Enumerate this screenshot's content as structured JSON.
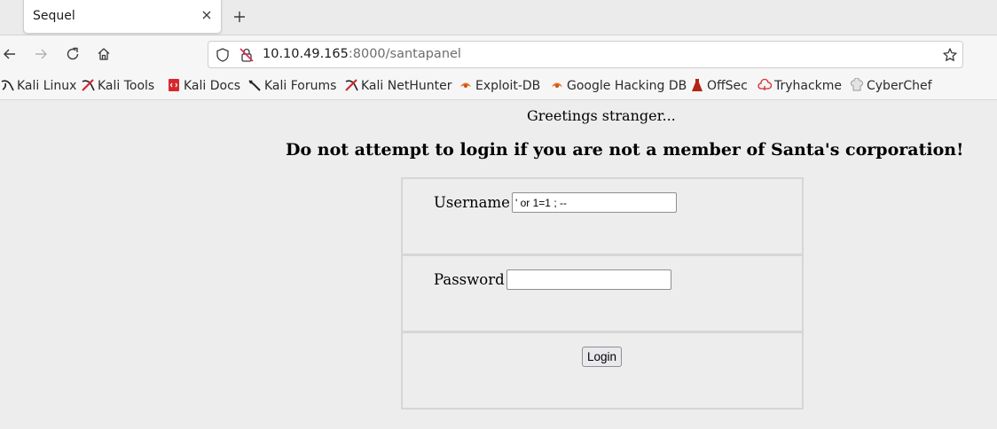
{
  "browser": {
    "tab_title": "Sequel",
    "url": {
      "host": "10.10.49.165",
      "rest": ":8000/santapanel"
    },
    "bookmarks": [
      {
        "label": "Kali Linux",
        "icon": "kali-dragon-icon"
      },
      {
        "label": "Kali Tools",
        "icon": "kali-tools-icon"
      },
      {
        "label": "Kali Docs",
        "icon": "kali-docs-icon"
      },
      {
        "label": "Kali Forums",
        "icon": "kali-forums-icon"
      },
      {
        "label": "Kali NetHunter",
        "icon": "kali-nethunter-icon"
      },
      {
        "label": "Exploit-DB",
        "icon": "exploit-db-icon"
      },
      {
        "label": "Google Hacking DB",
        "icon": "ghdb-icon"
      },
      {
        "label": "OffSec",
        "icon": "offsec-icon"
      },
      {
        "label": "Tryhackme",
        "icon": "tryhackme-icon"
      },
      {
        "label": "CyberChef",
        "icon": "cyberchef-icon"
      }
    ]
  },
  "page": {
    "greeting": "Greetings stranger...",
    "warning": "Do not attempt to login if you are not a member of Santa's corporation!",
    "username_label": "Username",
    "username_value": "' or 1=1 ; --",
    "password_label": "Password",
    "password_value": "",
    "login_label": "Login"
  },
  "colors": {
    "page_background": "#ededed",
    "panel_border": "#d6d6d6",
    "exploit_icon": "#e8762d",
    "offsec_icon": "#b22417",
    "kali_tools_icon": "#d7282f"
  }
}
